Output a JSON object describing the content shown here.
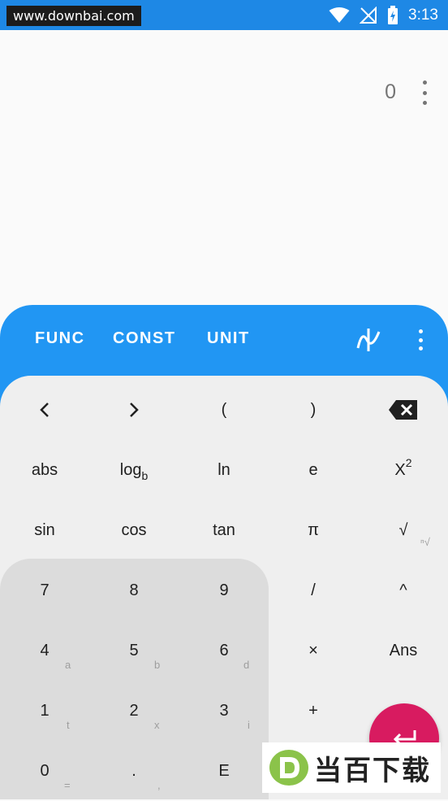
{
  "statusbar": {
    "watermark": "www.downbai.com",
    "time": "3:13"
  },
  "display": {
    "value": "0"
  },
  "tabs": [
    "FUNC",
    "CONST",
    "UNIT"
  ],
  "keys": {
    "row1": [
      "(",
      ")"
    ],
    "row2": {
      "abs": "abs",
      "log": "log",
      "log_sub": "b",
      "ln": "ln",
      "e": "e",
      "x": "X",
      "x_sup": "2"
    },
    "row3": {
      "sin": "sin",
      "cos": "cos",
      "tan": "tan",
      "pi": "π",
      "sqrt": "√",
      "sqrt_sub": "ⁿ√"
    },
    "num7": "7",
    "num8": "8",
    "num9": "9",
    "divide": "/",
    "power": "^",
    "num4": "4",
    "num4_sub": "a",
    "num5": "5",
    "num5_sub": "b",
    "num6": "6",
    "num6_sub": "d",
    "multiply": "×",
    "ans": "Ans",
    "num1": "1",
    "num1_sub": "t",
    "num2": "2",
    "num2_sub": "x",
    "num3": "3",
    "num3_sub": "i",
    "plus": "+",
    "num0": "0",
    "num0_sub": "=",
    "dot": ".",
    "dot_sub": ",",
    "exp": "E"
  },
  "watermark_logo": "当百下载",
  "colors": {
    "primary": "#2196f3",
    "accent": "#d81b60"
  }
}
